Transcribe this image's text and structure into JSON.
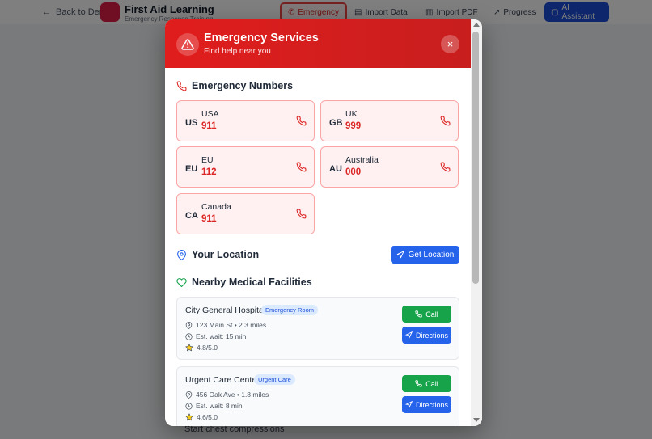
{
  "background": {
    "back_label": "Back to Demo",
    "app_title": "First Aid Learning",
    "app_subtitle": "Emergency Response Training",
    "nav": {
      "emergency": "Emergency",
      "import_data": "Import Data",
      "import_pdf": "Import PDF",
      "progress": "Progress",
      "ai_assistant": "AI Assistant"
    },
    "main_text": "Start chest compressions"
  },
  "modal": {
    "title": "Emergency Services",
    "subtitle": "Find help near you",
    "close_symbol": "×",
    "emergency_numbers_title": "Emergency Numbers",
    "numbers": [
      {
        "code": "US",
        "country": "USA",
        "number": "911"
      },
      {
        "code": "GB",
        "country": "UK",
        "number": "999"
      },
      {
        "code": "EU",
        "country": "EU",
        "number": "112"
      },
      {
        "code": "AU",
        "country": "Australia",
        "number": "000"
      },
      {
        "code": "CA",
        "country": "Canada",
        "number": "911"
      }
    ],
    "location_title": "Your Location",
    "get_location_label": "Get Location",
    "facilities_title": "Nearby Medical Facilities",
    "facilities": [
      {
        "name": "City General Hospital",
        "badge": "Emergency Room",
        "address": "123 Main St • 2.3 miles",
        "wait": "Est. wait: 15 min",
        "rating": "4.8/5.0",
        "call_label": "Call",
        "directions_label": "Directions"
      },
      {
        "name": "Urgent Care Center",
        "badge": "Urgent Care",
        "address": "456 Oak Ave • 1.8 miles",
        "wait": "Est. wait: 8 min",
        "rating": "4.6/5.0",
        "call_label": "Call",
        "directions_label": "Directions"
      }
    ]
  },
  "colors": {
    "header_red": "#dc2626",
    "card_bg": "#fff1f1",
    "number_red": "#dc2626",
    "primary_blue": "#2563eb",
    "call_green": "#16a34a"
  },
  "icons": {
    "header": "alert-triangle-icon",
    "numbers": "phone-icon",
    "location": "map-pin-icon",
    "get_location": "navigation-icon",
    "facilities": "heart-icon",
    "address": "map-pin-icon",
    "wait": "clock-icon",
    "rating": "star-icon"
  }
}
